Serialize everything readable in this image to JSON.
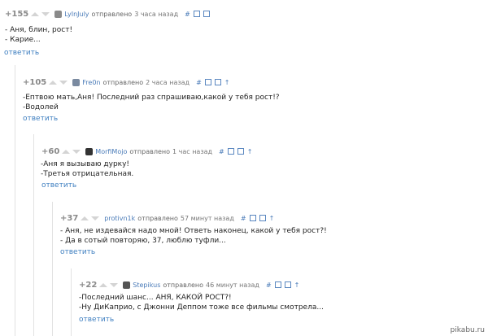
{
  "comments": [
    {
      "rating": "+155",
      "author": "LyInJuly",
      "sent": "отправлено",
      "time": "3 часа назад",
      "lines": [
        "- Аня, блин, рост!",
        "- Карие..."
      ],
      "reply": "ответить",
      "avatar_color": "#8a8a8a"
    },
    {
      "rating": "+105",
      "author": "Fre0n",
      "sent": "отправлено",
      "time": "2 часа назад",
      "lines": [
        "-Ептвою мать,Аня! Последний раз спрашиваю,какой у тебя рост!?",
        "-Водолей"
      ],
      "reply": "ответить",
      "avatar_color": "#7a8aa0"
    },
    {
      "rating": "+60",
      "author": "MorfiMojo",
      "sent": "отправлено",
      "time": "1 час назад",
      "lines": [
        "-Аня я вызываю дурку!",
        "-Третья отрицательная."
      ],
      "reply": "ответить",
      "avatar_color": "#333333"
    },
    {
      "rating": "+37",
      "author": "protivn1k",
      "sent": "отправлено",
      "time": "57 минут назад",
      "lines": [
        "- Аня, не издевайся надо мной! Ответь наконец, какой у тебя рост?!",
        "- Да в сотый повторяю, 37, люблю туфли..."
      ],
      "reply": "ответить",
      "avatar_color": ""
    },
    {
      "rating": "+22",
      "author": "Stepikus",
      "sent": "отправлено",
      "time": "46 минут назад",
      "lines": [
        "-Последний шанс... АНЯ, КАКОЙ РОСТ?!",
        "-Ну ДиКаприо, с Джонни Деппом тоже все фильмы смотрела..."
      ],
      "reply": "ответить",
      "avatar_color": "#555555"
    }
  ],
  "toolbar": {
    "hash": "#",
    "up": "↑"
  },
  "watermark": "pikabu.ru"
}
